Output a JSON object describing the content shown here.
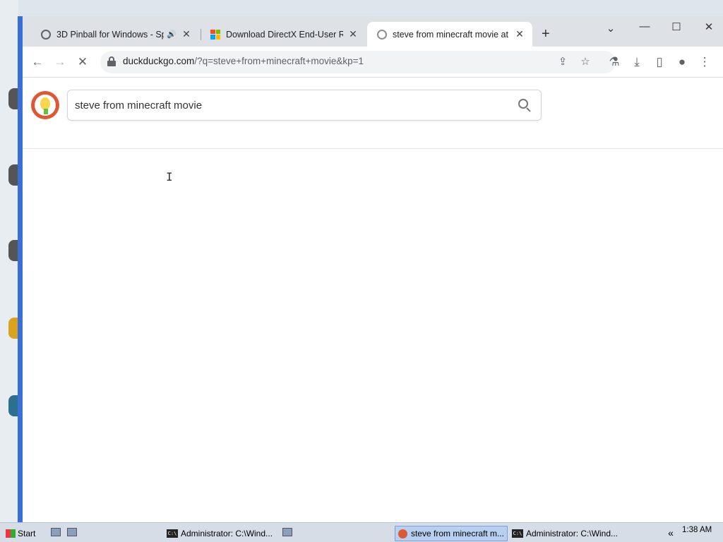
{
  "browser": {
    "tabs": [
      {
        "title": "3D Pinball for Windows - Sp",
        "favicon": "globe-icon",
        "audio": true
      },
      {
        "title": "Download DirectX End-User Ru",
        "favicon": "microsoft-icon",
        "audio": false
      },
      {
        "title": "steve from minecraft movie at D",
        "favicon": "duckduckgo-icon",
        "audio": false,
        "active": true
      }
    ],
    "url_domain": "duckduckgo.com",
    "url_rest": "/?q=steve+from+minecraft+movie&kp=1"
  },
  "search": {
    "query": "steve from minecraft movie"
  },
  "taskbar": {
    "start_label": "Start",
    "items": [
      {
        "label": "Administrator: C:\\Wind..."
      },
      {
        "label": "steve from minecraft m..."
      },
      {
        "label": "Administrator: C:\\Wind..."
      }
    ],
    "clock": "1:38 AM"
  },
  "colors": {
    "accent": "#3a6fd8",
    "ddg_orange": "#de5833",
    "tab_bar": "#dee1e6"
  }
}
